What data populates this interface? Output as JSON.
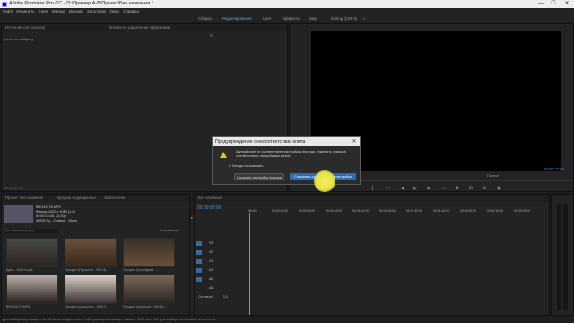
{
  "titlebar": {
    "title": "Adobe Premiere Pro CC - D:\\Пример А-Б\\Проект\\Без названия *",
    "minimize": "—",
    "maximize": "☐",
    "close": "✕"
  },
  "menu": [
    "Файл",
    "Изменить",
    "Клип",
    "Эпизод",
    "Маркер",
    "Заголовок",
    "Окно",
    "Справка"
  ],
  "workspaces": [
    {
      "label": "Сборка",
      "active": false
    },
    {
      "label": "Редактирование",
      "active": true
    },
    {
      "label": "Цвет",
      "active": false
    },
    {
      "label": "Эффекты",
      "active": false
    },
    {
      "label": "Звук",
      "active": false
    },
    {
      "label": "Editing (CS5.5)",
      "active": false
    },
    {
      "label": "»",
      "active": false
    }
  ],
  "source_panel": {
    "tab1": "Источник: (нет клипов)",
    "tab2": "Элементы управления эффектами",
    "empty_text": "(клип не выбран)",
    "timecode": "00;00;00;00"
  },
  "program_monitor": {
    "timecode_right": "00:00:17:08",
    "zoom": "Полное"
  },
  "project_panel": {
    "tab1": "Проект: Без названия",
    "tab2": "Браузер медиаданных",
    "tab3": "Библиотеки",
    "selected_clip": {
      "name": "BRG43176.MP4",
      "info1": "Фильм, 1920 x 1080 (1,0)",
      "info2": "00:00:15:05, 25,00p",
      "info3": "48000 Гц - Сжатый - Моно"
    },
    "search_placeholder": "Без названия.prproj",
    "items_count": "5 элементов",
    "clips": [
      {
        "label": "Дань - 00013.mp4",
        "duration": "17:08"
      },
      {
        "label": "Процесс (Прошлое - 00013)...",
        "duration": "15:05"
      },
      {
        "label": "Процесс (последний - ...",
        "duration": "6:19"
      },
      {
        "label": "BRG43176.MP4",
        "duration": "10:05"
      },
      {
        "label": "Процесс (прошлое) - 00013...",
        "duration": "3:16"
      },
      {
        "label": "Процесс (прошлое - 00013)...",
        "duration": "15:04"
      }
    ]
  },
  "timeline": {
    "tab": "Без названия",
    "timecode": "00:00:00:00",
    "ruler": [
      "00:00",
      "00:00:15:00",
      "00:00:30:00",
      "00:00:45:00",
      "00:01:00:00",
      "00:01:15:00",
      "00:01:30:00",
      "00:01:45:00",
      "00:02:00:00",
      "00:02:15:00",
      "00:02:30:00"
    ],
    "tracks": [
      "V3",
      "V2",
      "V1",
      "A1",
      "A2",
      "A3"
    ],
    "master": "Основной",
    "master_value": "0,0"
  },
  "dialog": {
    "title": "Предупреждение о несоответствии клипа",
    "message": "Данный клип не соответствует настройкам эпизода. Изменить эпизод в соответствии с настройками клипа?",
    "checkbox_label": "Всегда спрашивать",
    "btn_keep": "Начинать настройки эпизода",
    "btn_change": "Сохранить существующие настройки"
  },
  "status": "Для выбора перетащите за областью выделения. Чтобы расширить выбор нажмите Shift, Alt и Ctrl для выбора нескольких элементов."
}
